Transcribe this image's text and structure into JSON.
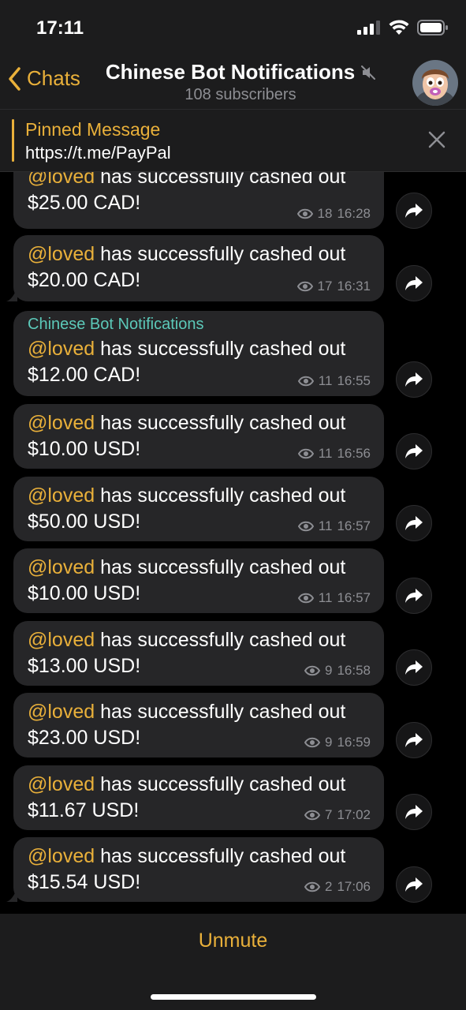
{
  "status_bar": {
    "time": "17:11"
  },
  "header": {
    "back_label": "Chats",
    "title": "Chinese Bot Notifications",
    "subtitle": "108 subscribers"
  },
  "pinned": {
    "title": "Pinned Message",
    "text": "https://t.me/PayPal"
  },
  "messages": [
    {
      "mention": "@loved",
      "text": " has successfully cashed out",
      "amount": "$25.00 CAD!",
      "views": "18",
      "time": "16:28"
    },
    {
      "mention": "@loved",
      "text": " has successfully cashed out",
      "amount": "$20.00 CAD!",
      "views": "17",
      "time": "16:31"
    },
    {
      "author": "Chinese Bot Notifications",
      "mention": "@loved",
      "text": " has successfully cashed out",
      "amount": "$12.00 CAD!",
      "views": "11",
      "time": "16:55"
    },
    {
      "mention": "@loved",
      "text": " has successfully cashed out",
      "amount": "$10.00 USD!",
      "views": "11",
      "time": "16:56"
    },
    {
      "mention": "@loved",
      "text": " has successfully cashed out",
      "amount": "$50.00 USD!",
      "views": "11",
      "time": "16:57"
    },
    {
      "mention": "@loved",
      "text": " has successfully cashed out",
      "amount": "$10.00 USD!",
      "views": "11",
      "time": "16:57"
    },
    {
      "mention": "@loved",
      "text": " has successfully cashed out",
      "amount": "$13.00 USD!",
      "views": "9",
      "time": "16:58"
    },
    {
      "mention": "@loved",
      "text": " has successfully cashed out",
      "amount": "$23.00 USD!",
      "views": "9",
      "time": "16:59"
    },
    {
      "mention": "@loved",
      "text": " has successfully cashed out",
      "amount": "$11.67 USD!",
      "views": "7",
      "time": "17:02"
    },
    {
      "mention": "@loved",
      "text": " has successfully cashed out",
      "amount": "$15.54 USD!",
      "views": "2",
      "time": "17:06"
    }
  ],
  "bottom": {
    "unmute_label": "Unmute"
  },
  "colors": {
    "accent": "#e9b03a",
    "author": "#5cc9b9",
    "bubble": "#262628",
    "bar": "#1c1c1d",
    "meta": "#8d8e93"
  },
  "icons": {
    "status": [
      "signal-icon",
      "wifi-icon",
      "battery-icon"
    ],
    "header": [
      "chevron-left-icon",
      "muted-speaker-icon",
      "avatar"
    ],
    "pinned": [
      "close-icon"
    ],
    "message": [
      "eye-icon",
      "share-icon"
    ]
  }
}
